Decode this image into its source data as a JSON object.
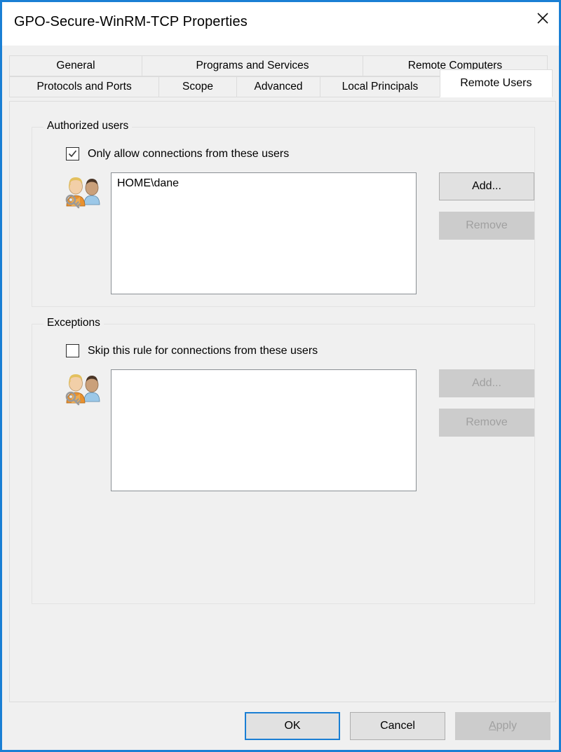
{
  "window": {
    "title": "GPO-Secure-WinRM-TCP Properties",
    "close_icon": "close-icon",
    "accent_color": "#1a7fd4",
    "face_color": "#f0f0f0"
  },
  "tabs": {
    "row1": [
      {
        "label": "General",
        "active": false
      },
      {
        "label": "Programs and Services",
        "active": false
      },
      {
        "label": "Remote Computers",
        "active": false
      }
    ],
    "row2": [
      {
        "label": "Protocols and Ports",
        "active": false
      },
      {
        "label": "Scope",
        "active": false
      },
      {
        "label": "Advanced",
        "active": false
      },
      {
        "label": "Local Principals",
        "active": false
      },
      {
        "label": "Remote Users",
        "active": true
      }
    ]
  },
  "authorized_users": {
    "group_title": "Authorized users",
    "checkbox_label": "Only allow connections from these users",
    "checkbox_checked": true,
    "icon": "users-with-key-icon",
    "list_items": [
      "HOME\\dane"
    ],
    "add_label": "Add...",
    "add_enabled": true,
    "remove_label": "Remove",
    "remove_enabled": false
  },
  "exceptions": {
    "group_title": "Exceptions",
    "checkbox_label": "Skip this rule for connections from these users",
    "checkbox_checked": false,
    "icon": "users-with-key-icon",
    "list_items": [],
    "add_label": "Add...",
    "add_enabled": false,
    "remove_label": "Remove",
    "remove_enabled": false
  },
  "footer": {
    "ok_label": "OK",
    "cancel_label": "Cancel",
    "apply_accel": "A",
    "apply_rest": "pply",
    "apply_enabled": false
  }
}
